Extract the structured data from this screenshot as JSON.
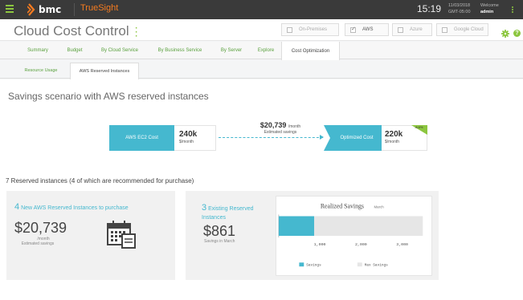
{
  "topbar": {
    "brand": "bmc",
    "product": "TrueSight",
    "time": "15:19",
    "date": "11/03/2018",
    "timezone": "GMT-05:00",
    "welcome_label": "Welcome",
    "user": "admin"
  },
  "header": {
    "title": "Cloud Cost Control",
    "filters": [
      {
        "label": "On-Premises",
        "checked": false
      },
      {
        "label": "AWS",
        "checked": true
      },
      {
        "label": "Azure",
        "checked": false
      },
      {
        "label": "Google Cloud",
        "checked": false
      }
    ]
  },
  "tabs": [
    "Summary",
    "Budget",
    "By Cloud Service",
    "By Business Service",
    "By Server",
    "Explore",
    "Cost Optimization"
  ],
  "active_tab": "Cost Optimization",
  "subtabs": [
    "Resource Usage",
    "AWS Reserved Instances"
  ],
  "active_subtab": "AWS Reserved Instances",
  "scenario": {
    "title": "Savings scenario with AWS reserved instances",
    "ec2_label": "AWS EC2 Cost",
    "ec2_value": "240k",
    "ec2_unit": "$/month",
    "savings_value": "$20,739",
    "savings_period": "/month",
    "savings_label": "Estimated savings",
    "optimized_label": "Optimized Cost",
    "optimized_value": "220k",
    "optimized_unit": "$/month",
    "badge": "-8.6%"
  },
  "reserved": {
    "title": "7 Reserved instances (4 of which are recommended for purchase)",
    "new_count": "4",
    "new_label": "New AWS Reserved Instances to purchase",
    "new_amount": "$20,739",
    "new_period": "/month",
    "new_sub": "Estimated savings",
    "existing_count": "3",
    "existing_label": "Existing Reserved Instances",
    "existing_amount": "$861",
    "existing_sub": "Savings in March"
  },
  "chart_data": {
    "type": "bar",
    "title": "Realized Savings",
    "subtitle": "March",
    "orientation": "horizontal",
    "series": [
      {
        "name": "Savings",
        "values": [
          861
        ],
        "color": "#45b8cf"
      },
      {
        "name": "Max Savings",
        "values": [
          3500
        ],
        "color": "#e6e6e6"
      }
    ],
    "xlim": [
      0,
      3500
    ],
    "ticks": [
      "1,000",
      "2,000",
      "3,000"
    ],
    "tick_values": [
      1000,
      2000,
      3000
    ]
  }
}
